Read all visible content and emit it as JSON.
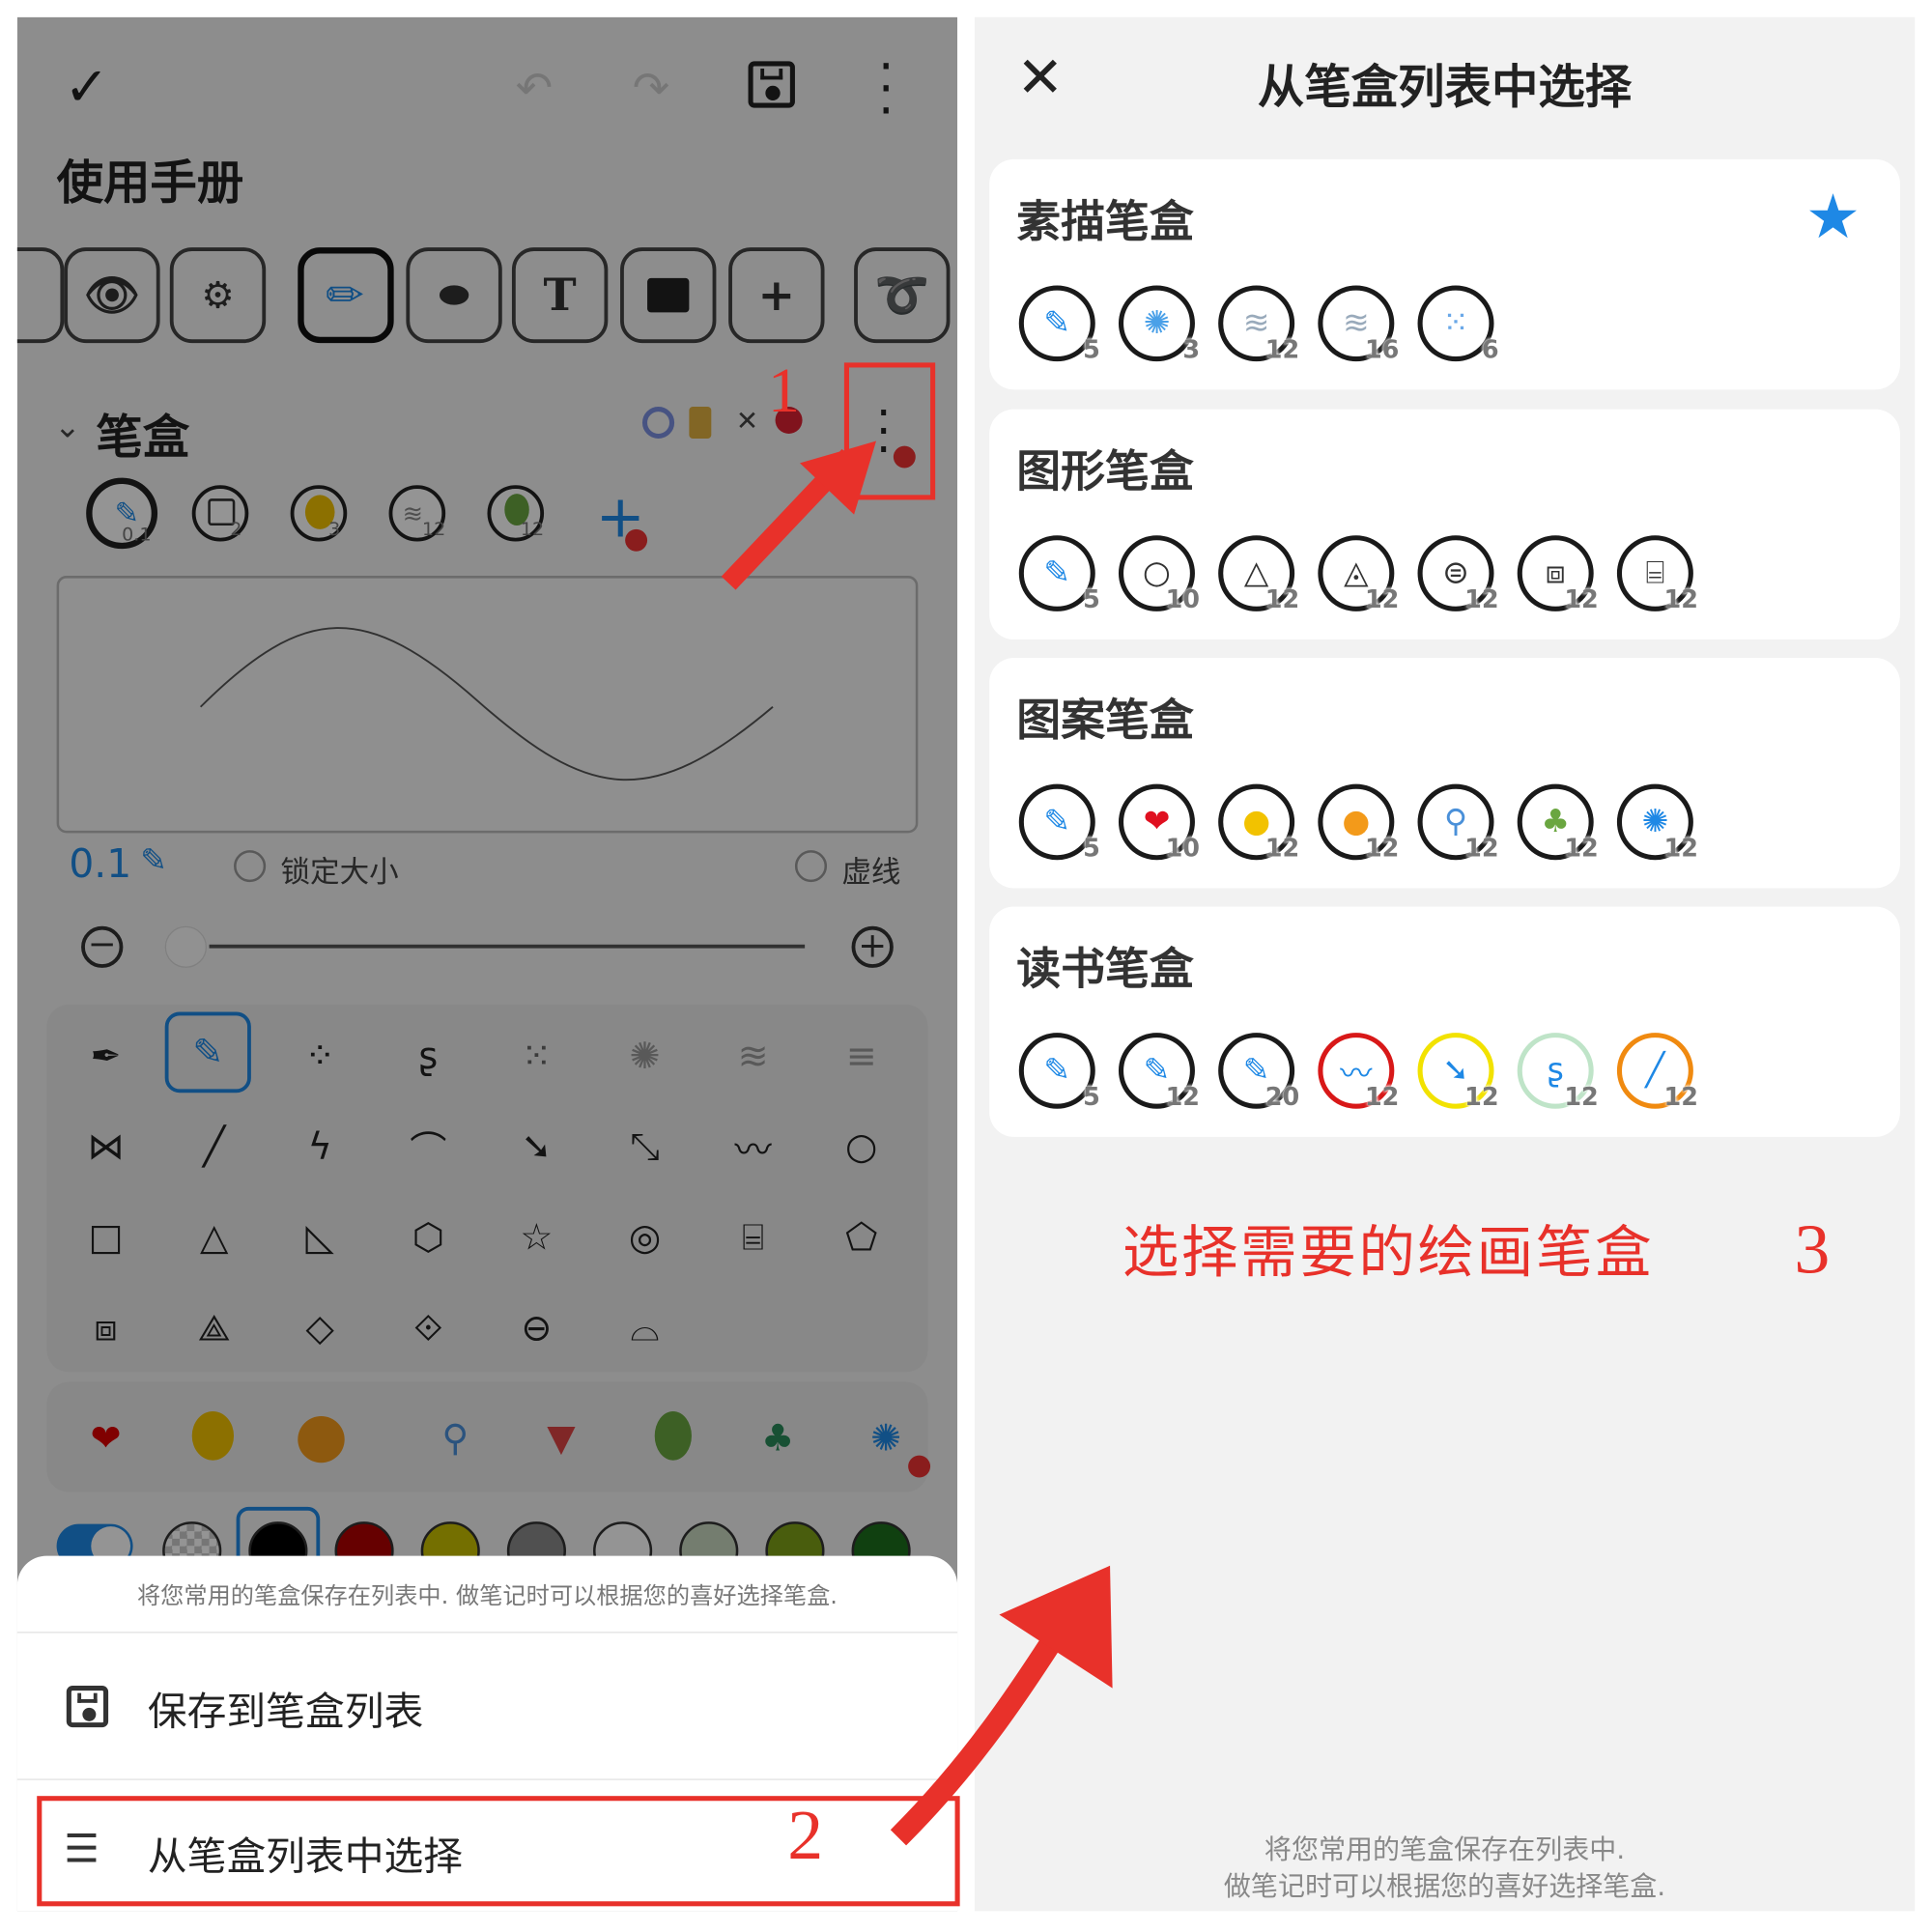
{
  "left_panel": {
    "title": "使用手册",
    "section_title": "笔盒",
    "size_value": "0.1",
    "lock_size_label": "锁定大小",
    "dashed_label": "虚线",
    "sheet_hint": "将您常用的笔盒保存在列表中. 做笔记时可以根据您的喜好选择笔盒.",
    "menu_save": "保存到笔盒列表",
    "menu_select": "从笔盒列表中选择",
    "pen_slot_numbers": [
      "0.1",
      "2",
      "3",
      "12",
      "12"
    ],
    "toolbar_text_tool": "T",
    "swatch_colors": [
      "#ffffff",
      "#000000",
      "#b00000",
      "#c8c000",
      "#8a8a8a",
      "#ffffff",
      "#c9d8c0",
      "#7ea018",
      "#1c6e1c"
    ]
  },
  "right_panel": {
    "title": "从笔盒列表中选择",
    "hint_line1": "将您常用的笔盒保存在列表中.",
    "hint_line2": "做笔记时可以根据您的喜好选择笔盒.",
    "boxes": [
      {
        "name": "素描笔盒",
        "starred": true,
        "pens": [
          {
            "n": "5"
          },
          {
            "n": "3"
          },
          {
            "n": "12"
          },
          {
            "n": "16"
          },
          {
            "n": "6"
          }
        ]
      },
      {
        "name": "图形笔盒",
        "starred": false,
        "pens": [
          {
            "n": "5"
          },
          {
            "n": "10"
          },
          {
            "n": "12"
          },
          {
            "n": "12"
          },
          {
            "n": "12"
          },
          {
            "n": "12"
          },
          {
            "n": "12"
          }
        ]
      },
      {
        "name": "图案笔盒",
        "starred": false,
        "pens": [
          {
            "n": "5"
          },
          {
            "n": "10"
          },
          {
            "n": "12"
          },
          {
            "n": "12"
          },
          {
            "n": "12"
          },
          {
            "n": "12"
          },
          {
            "n": "12"
          }
        ]
      },
      {
        "name": "读书笔盒",
        "starred": false,
        "pens": [
          {
            "n": "5"
          },
          {
            "n": "12"
          },
          {
            "n": "20"
          },
          {
            "n": "12"
          },
          {
            "n": "12"
          },
          {
            "n": "12"
          },
          {
            "n": "12"
          }
        ]
      }
    ]
  },
  "annotations": {
    "step1": "1",
    "step2": "2",
    "step3": "3",
    "step3_text": "选择需要的绘画笔盒",
    "accent_red": "#e8312a"
  },
  "colors": {
    "accent_blue": "#1e88e5",
    "star_blue": "#1e88e5"
  }
}
